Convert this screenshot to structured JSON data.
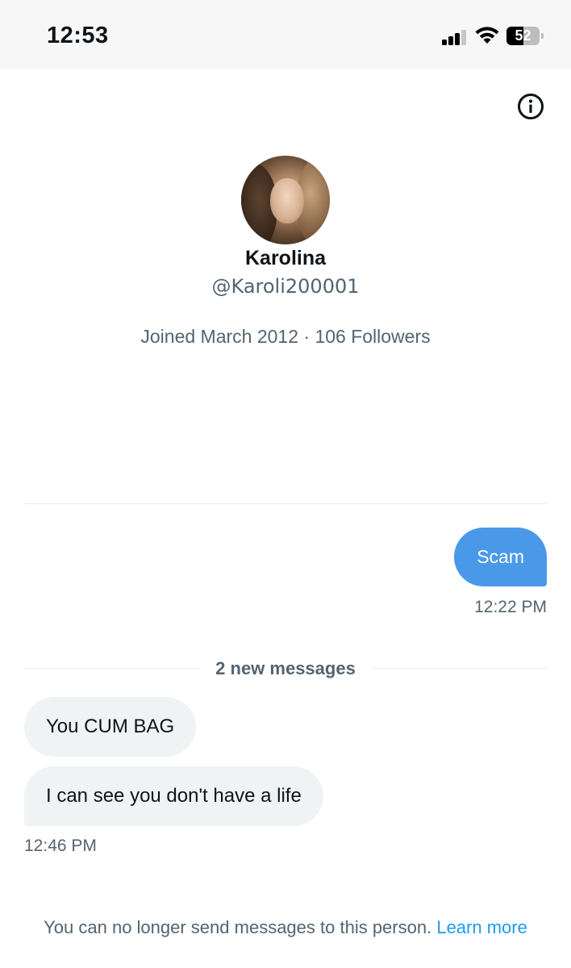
{
  "status_bar": {
    "time": "12:53",
    "battery_level": "52",
    "battery_fraction": 0.52,
    "signal_bars_active": 3,
    "signal_bars_total": 4,
    "icons": [
      "cellular-signal-icon",
      "wifi-icon",
      "battery-icon"
    ]
  },
  "header": {
    "info_icon": "info-icon"
  },
  "profile": {
    "name": "Karolina",
    "handle": "@Karoli200001",
    "meta": "Joined March 2012 · 106 Followers"
  },
  "conversation": {
    "sent": [
      {
        "text": "Scam",
        "time": "12:22 PM"
      }
    ],
    "new_messages_label": "2 new messages",
    "received": [
      {
        "text": "You CUM BAG"
      },
      {
        "text": "I can see you don't have a life"
      }
    ],
    "received_time": "12:46 PM"
  },
  "footer": {
    "notice": "You can no longer send messages to this person.",
    "learn_more": "Learn more"
  },
  "colors": {
    "sent_bubble": "#4a99e9",
    "received_bubble": "#eff3f4",
    "secondary_text": "#536471",
    "link": "#1d9bf0"
  }
}
